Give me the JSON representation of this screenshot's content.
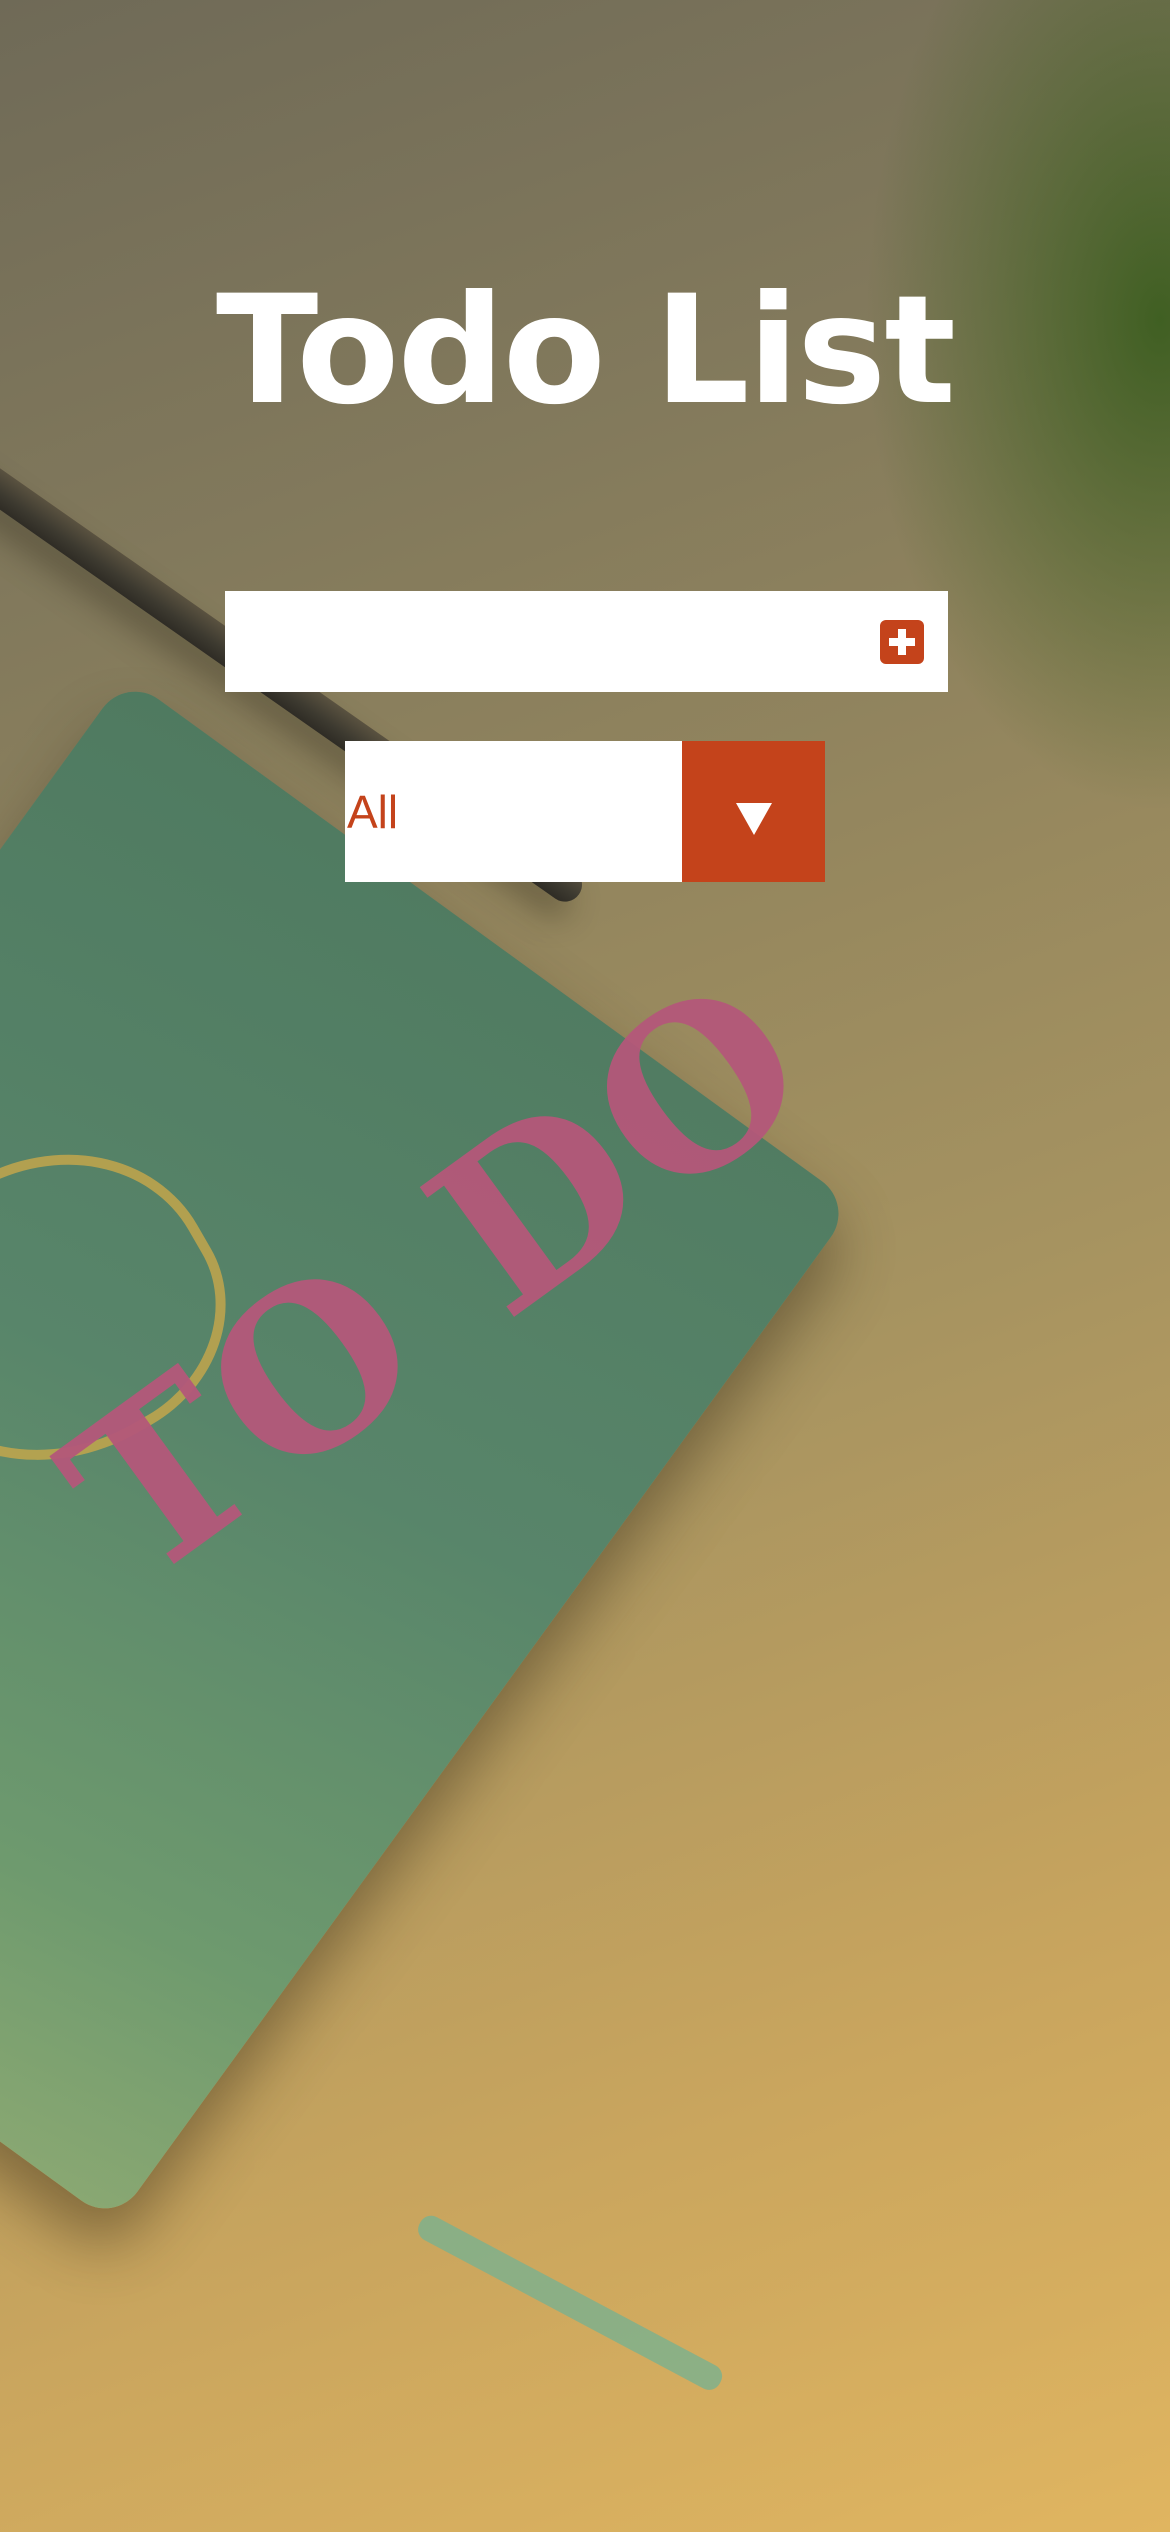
{
  "app": {
    "title": "Todo List"
  },
  "todo_form": {
    "input_value": "",
    "input_placeholder": "",
    "add_icon": "plus-square-icon"
  },
  "filter": {
    "selected": "All",
    "toggle_icon": "caret-down-icon"
  },
  "colors": {
    "accent": "#c4431b",
    "title": "#ffffff",
    "field_bg": "#ffffff"
  }
}
